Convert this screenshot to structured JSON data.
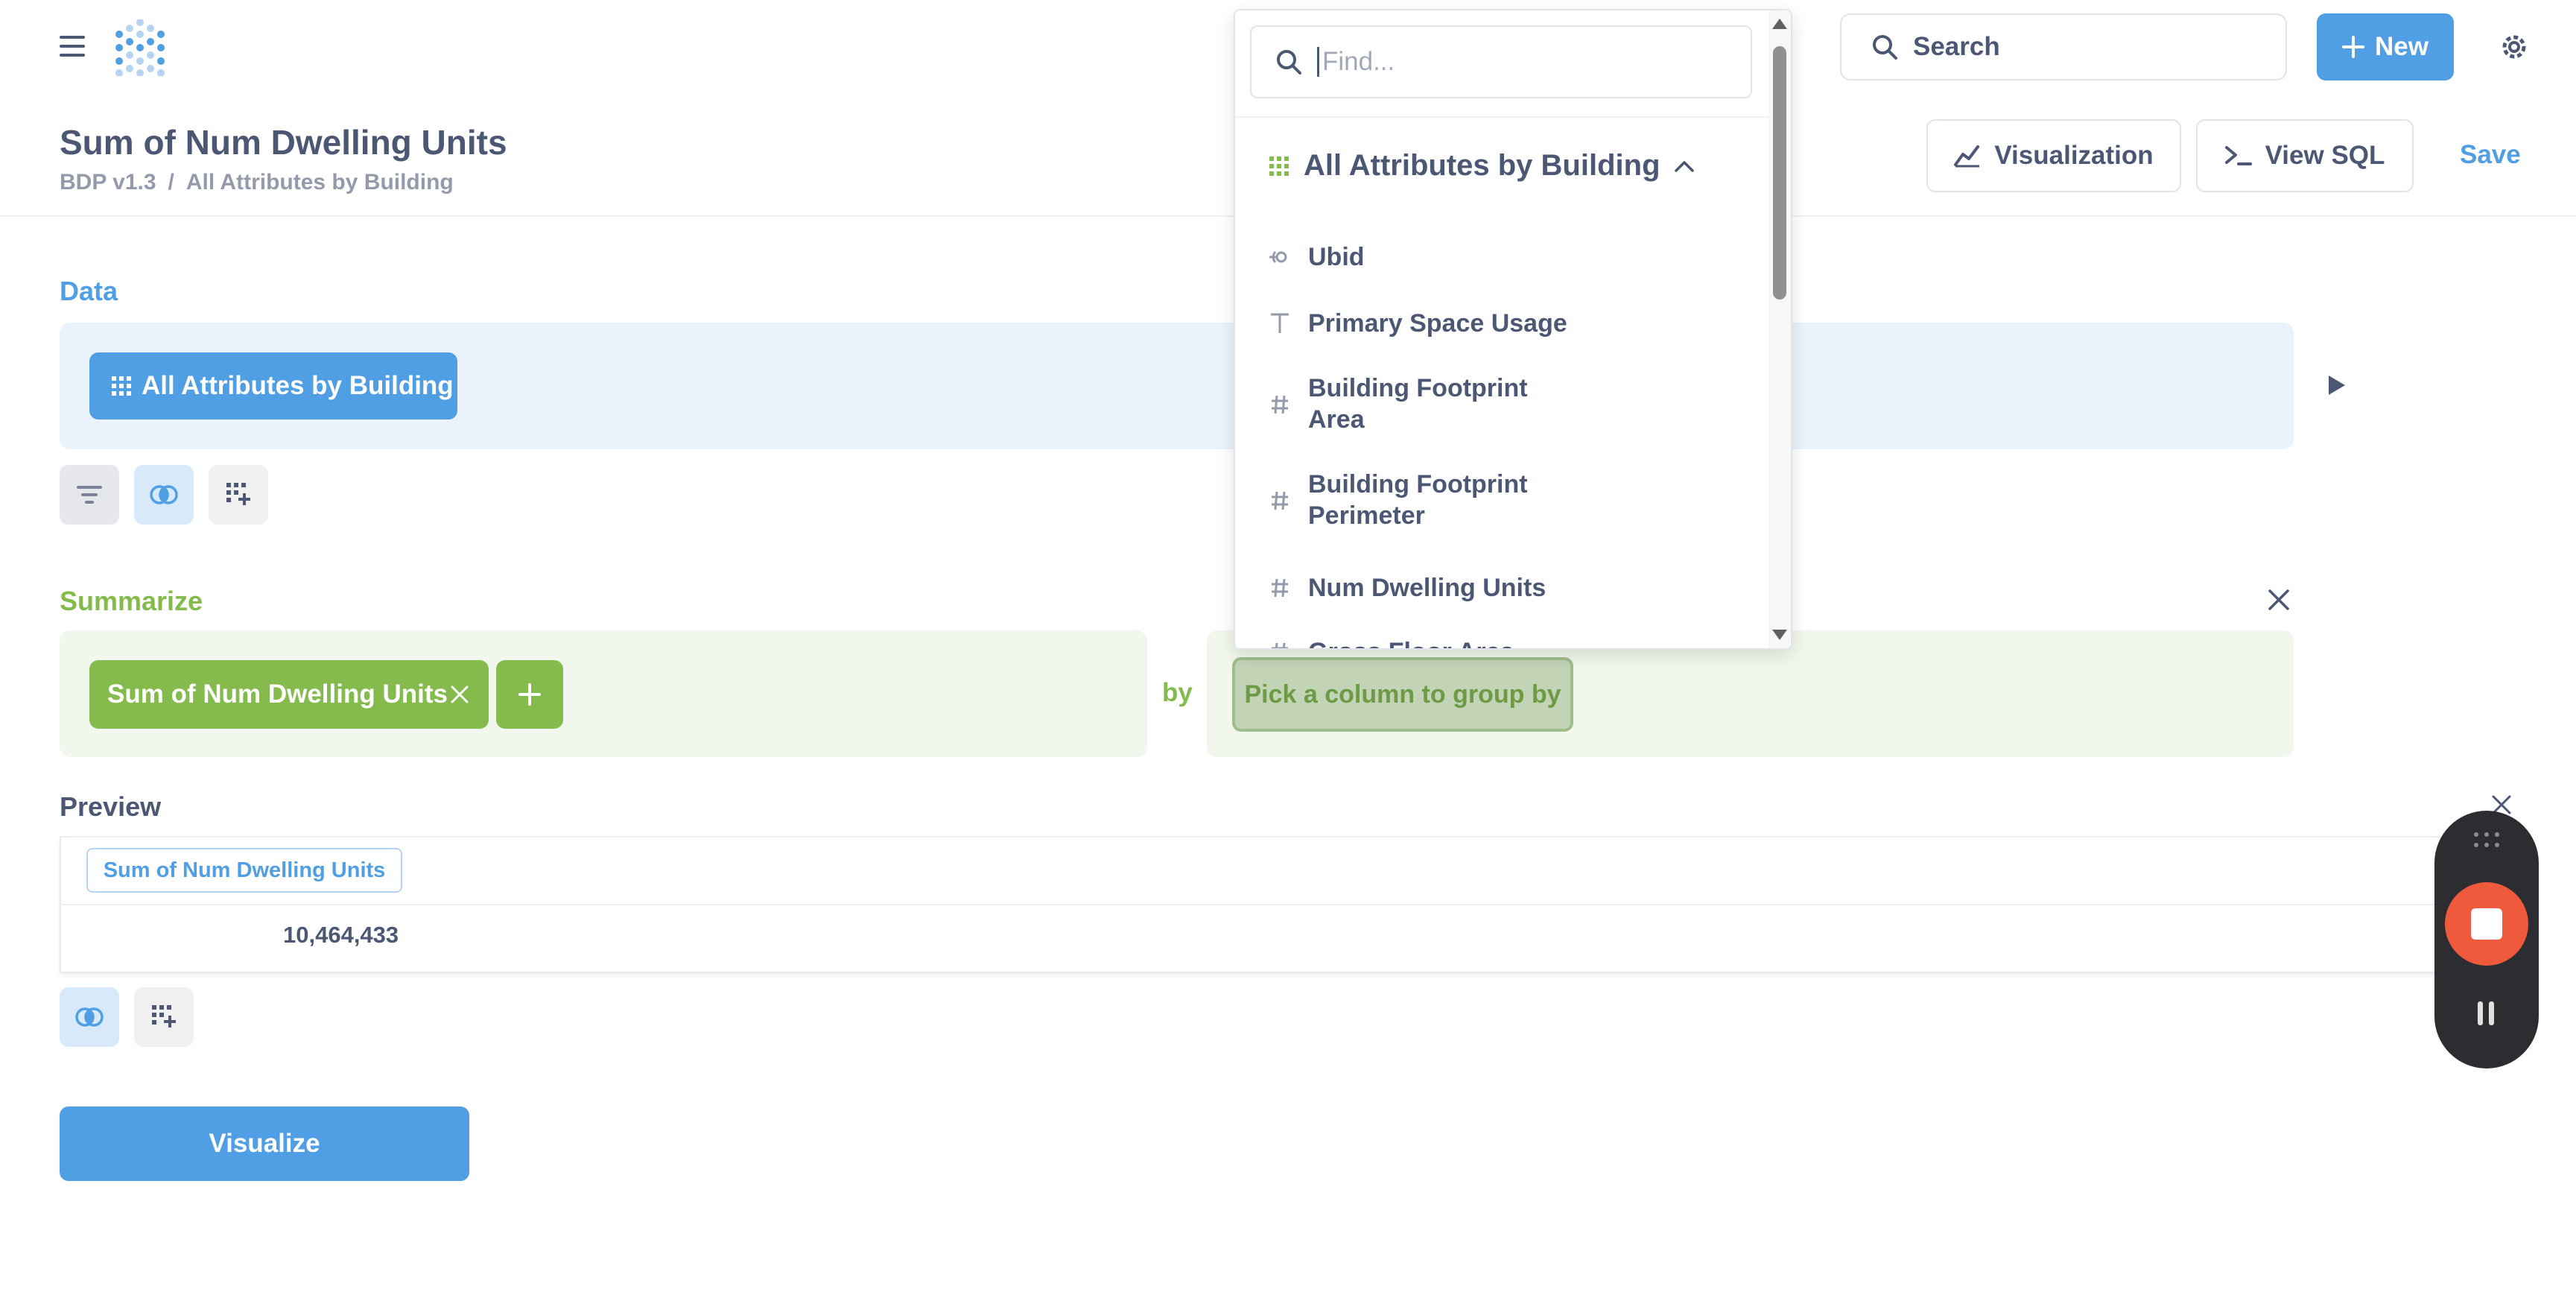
{
  "header": {
    "title": "Sum of Num Dwelling Units",
    "breadcrumb": {
      "database": "BDP v1.3",
      "separator": "/",
      "table": "All Attributes by Building"
    },
    "search_label": "Search",
    "new_label": "New",
    "visualization_label": "Visualization",
    "view_sql_label": "View SQL",
    "save_label": "Save"
  },
  "data_section": {
    "label": "Data",
    "table_pill": "All Attributes by Building"
  },
  "summarize_section": {
    "label": "Summarize",
    "metric": "Sum of Num Dwelling Units",
    "by_label": "by",
    "group_placeholder": "Pick a column to group by"
  },
  "preview": {
    "label": "Preview",
    "columns": [
      "Sum of Num Dwelling Units"
    ],
    "rows": [
      [
        "10,464,433"
      ]
    ]
  },
  "visualize_label": "Visualize",
  "column_picker": {
    "find_placeholder": "Find...",
    "table_name": "All Attributes by Building",
    "fields": [
      {
        "label": "Ubid",
        "icon": "foreign-key-icon"
      },
      {
        "label": "Primary Space Usage",
        "icon": "text-type-icon"
      },
      {
        "label": "Building Footprint\nArea",
        "icon": "number-type-icon"
      },
      {
        "label": "Building Footprint\nPerimeter",
        "icon": "number-type-icon"
      },
      {
        "label": "Num Dwelling Units",
        "icon": "number-type-icon"
      },
      {
        "label": "Gross Floor Area",
        "icon": "number-type-icon"
      }
    ]
  },
  "colors": {
    "brand_blue": "#509ee3",
    "summarize_green": "#84bb4c",
    "text_dark": "#4c5773",
    "recorder_stop": "#f05a3c"
  }
}
